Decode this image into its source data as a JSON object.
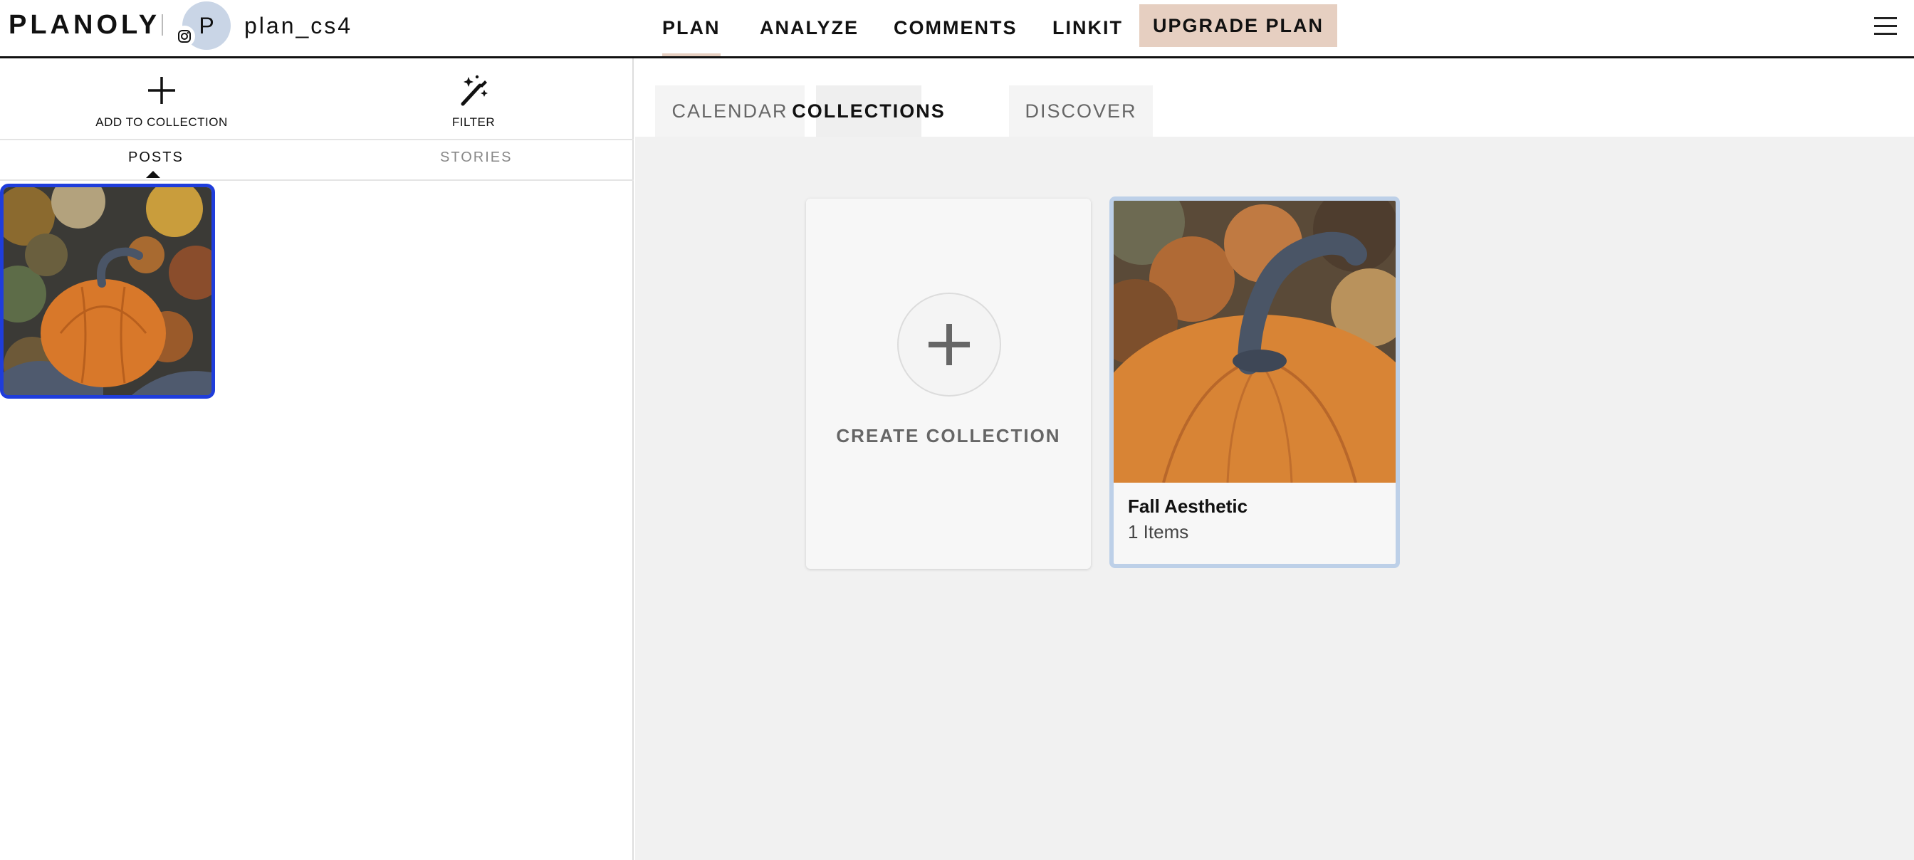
{
  "header": {
    "logo": "PLANOLY",
    "avatar_letter": "P",
    "account_name": "plan_cs4",
    "nav": {
      "plan": "PLAN",
      "analyze": "ANALYZE",
      "comments": "COMMENTS",
      "linkit": "LINKIT"
    },
    "upgrade_label": "UPGRADE PLAN",
    "accent_color": "#e6cfc1"
  },
  "left_panel": {
    "add_to_collection_label": "ADD TO COLLECTION",
    "filter_label": "FILTER",
    "tabs": {
      "posts": "POSTS",
      "stories": "STORIES"
    },
    "active_tab": "POSTS",
    "selected_border_color": "#1f3ddb"
  },
  "right_panel": {
    "tabs": {
      "calendar": "CALENDAR",
      "collections": "COLLECTIONS",
      "discover": "DISCOVER"
    },
    "active_tab": "COLLECTIONS",
    "create_collection_label": "CREATE COLLECTION",
    "collections": [
      {
        "name": "Fall Aesthetic",
        "count": "1 Items"
      }
    ]
  }
}
